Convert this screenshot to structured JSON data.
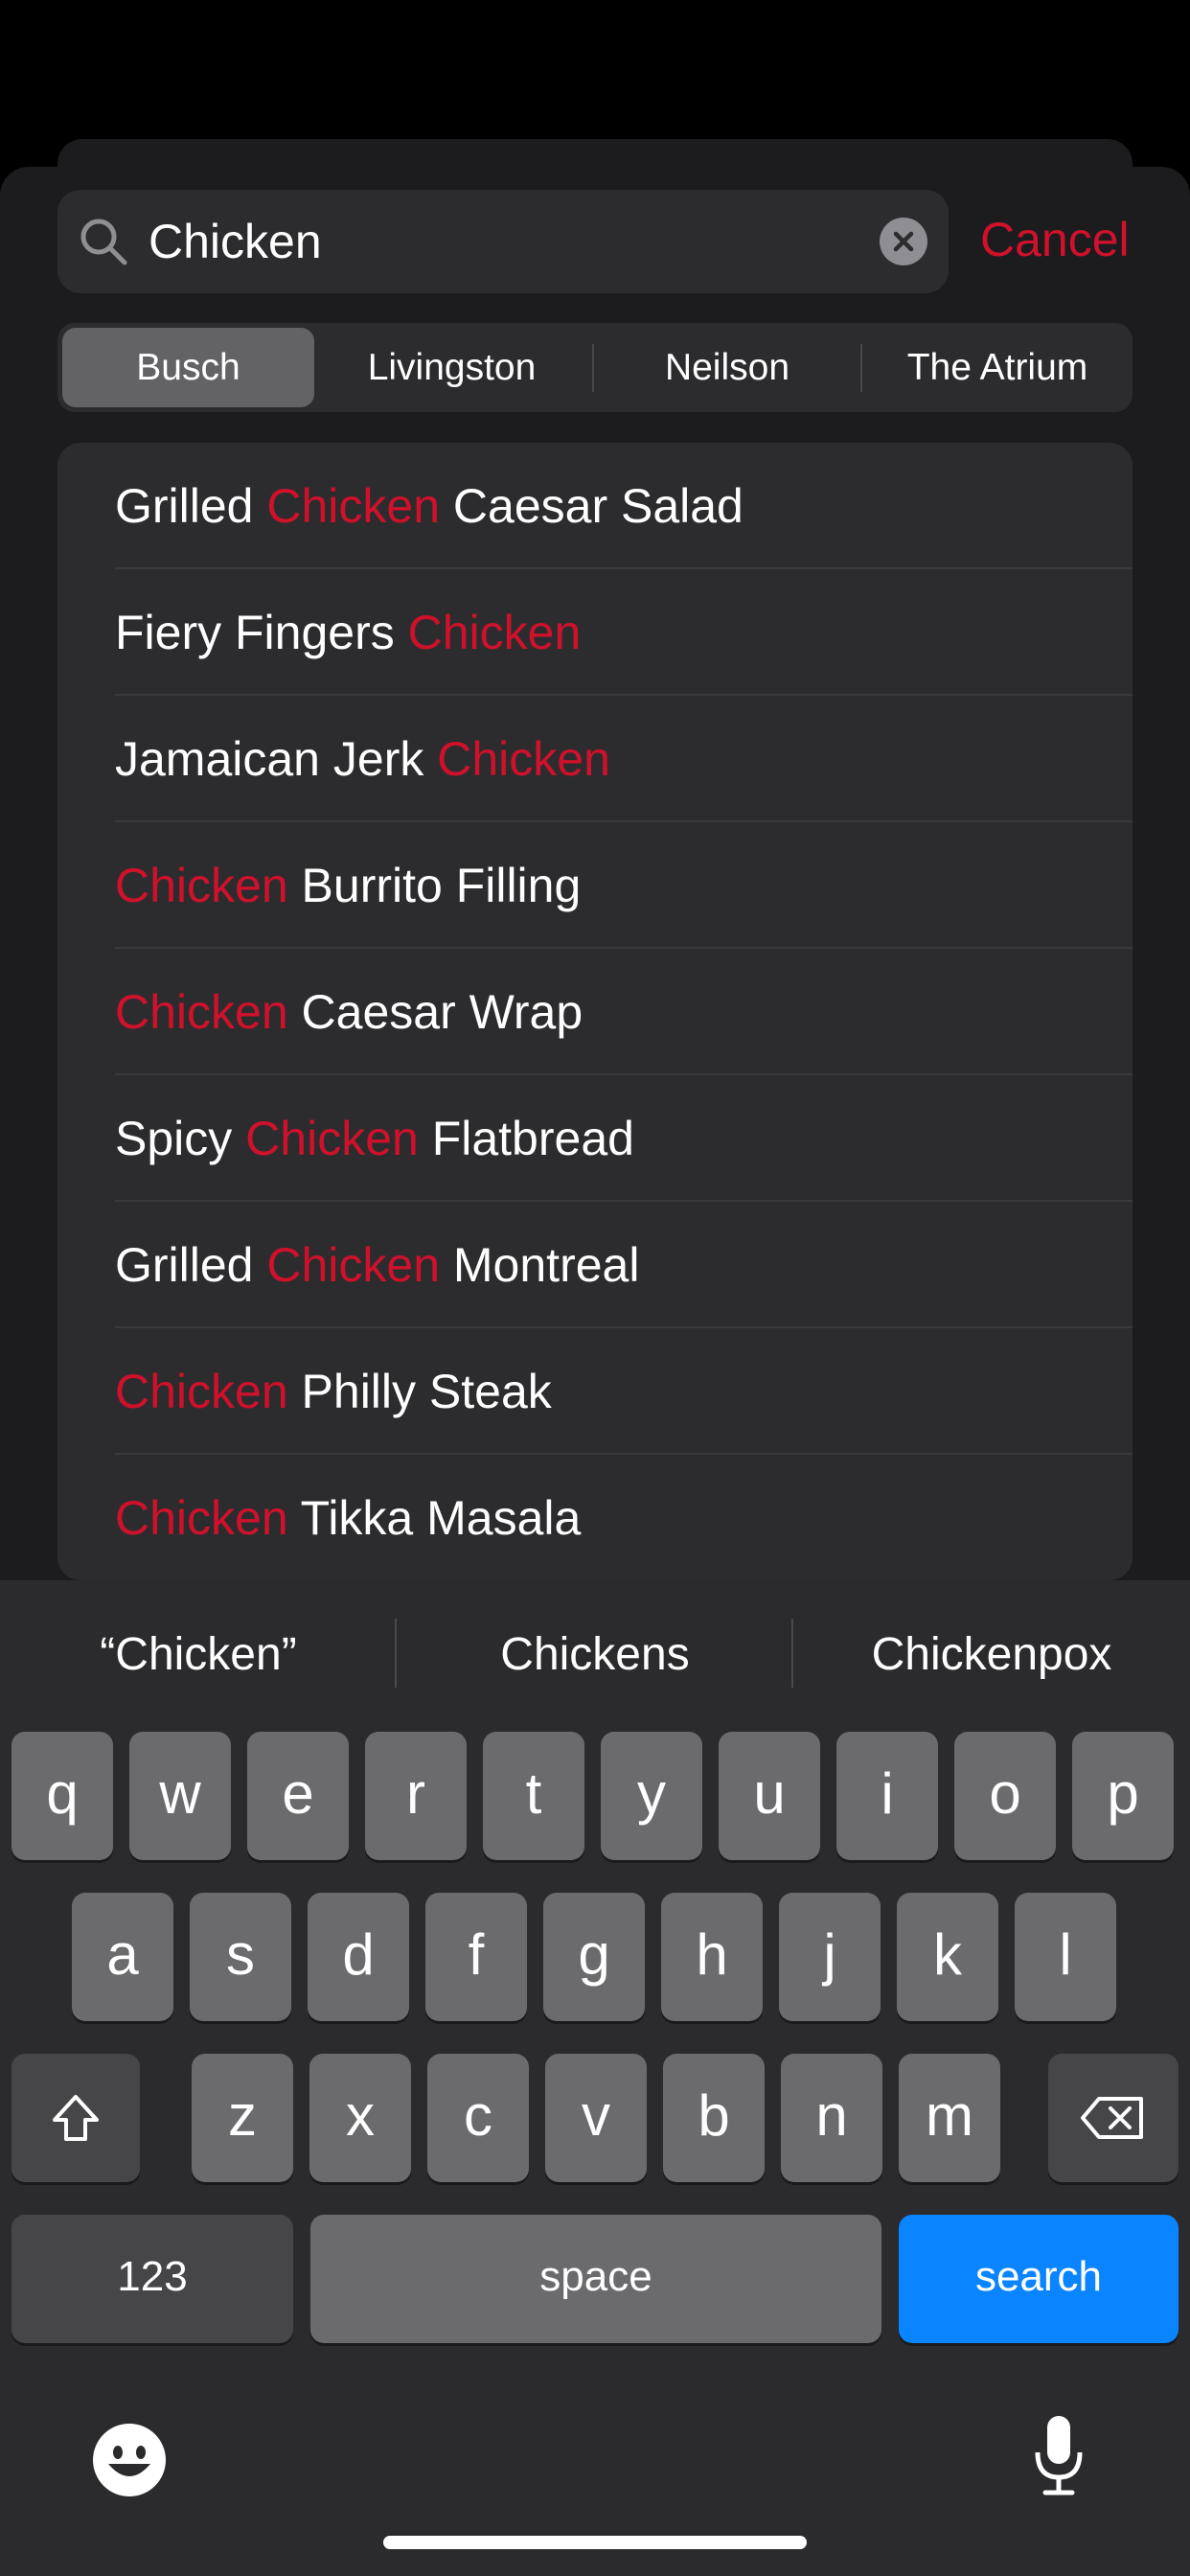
{
  "search": {
    "query": "Chicken",
    "cancel_label": "Cancel"
  },
  "segments": [
    "Busch",
    "Livingston",
    "Neilson",
    "The Atrium"
  ],
  "selected_segment": "Busch",
  "highlight_color": "#d0112b",
  "results": [
    [
      {
        "t": "Grilled ",
        "h": false
      },
      {
        "t": "Chicken",
        "h": true
      },
      {
        "t": " Caesar Salad",
        "h": false
      }
    ],
    [
      {
        "t": "Fiery Fingers ",
        "h": false
      },
      {
        "t": "Chicken",
        "h": true
      }
    ],
    [
      {
        "t": "Jamaican Jerk ",
        "h": false
      },
      {
        "t": "Chicken",
        "h": true
      }
    ],
    [
      {
        "t": "Chicken",
        "h": true
      },
      {
        "t": " Burrito Filling",
        "h": false
      }
    ],
    [
      {
        "t": "Chicken",
        "h": true
      },
      {
        "t": " Caesar Wrap",
        "h": false
      }
    ],
    [
      {
        "t": "Spicy ",
        "h": false
      },
      {
        "t": "Chicken",
        "h": true
      },
      {
        "t": " Flatbread",
        "h": false
      }
    ],
    [
      {
        "t": "Grilled ",
        "h": false
      },
      {
        "t": "Chicken",
        "h": true
      },
      {
        "t": " Montreal",
        "h": false
      }
    ],
    [
      {
        "t": "Chicken",
        "h": true
      },
      {
        "t": " Philly Steak",
        "h": false
      }
    ],
    [
      {
        "t": "Chicken",
        "h": true
      },
      {
        "t": " Tikka Masala",
        "h": false
      }
    ]
  ],
  "keyboard": {
    "suggestions": [
      "“Chicken”",
      "Chickens",
      "Chickenpox"
    ],
    "row1": [
      "q",
      "w",
      "e",
      "r",
      "t",
      "y",
      "u",
      "i",
      "o",
      "p"
    ],
    "row2": [
      "a",
      "s",
      "d",
      "f",
      "g",
      "h",
      "j",
      "k",
      "l"
    ],
    "row3": [
      "z",
      "x",
      "c",
      "v",
      "b",
      "n",
      "m"
    ],
    "numbers_label": "123",
    "space_label": "space",
    "search_label": "search",
    "search_color": "#0a84ff"
  }
}
